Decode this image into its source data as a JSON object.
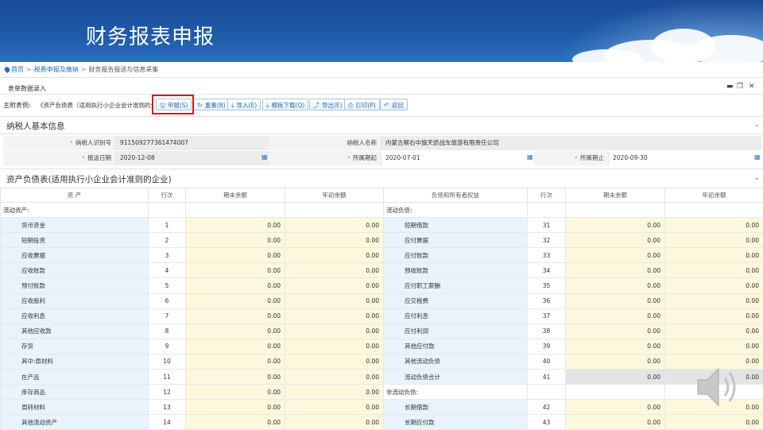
{
  "slide": {
    "title": "财务报表申报"
  },
  "breadcrumb": {
    "home": "首页",
    "level1": "税费申报及缴纳",
    "current": "财务报告报送与信息采集"
  },
  "panel": {
    "title": "表单数据录入"
  },
  "toolbar": {
    "attach_label": "主附表例:",
    "attach_value": "《资产负债表（适用执行小企业会计准则的企业）》",
    "buttons": [
      {
        "label": "申报(S)",
        "icon": "save-icon"
      },
      {
        "label": "重置(B)",
        "icon": "refresh-icon"
      },
      {
        "label": "导入(E)",
        "icon": "import-icon"
      },
      {
        "label": "模板下载(Q)",
        "icon": "download-icon"
      },
      {
        "label": "导出(E)",
        "icon": "export-icon"
      },
      {
        "label": "打印(P)",
        "icon": "print-icon"
      },
      {
        "label": "返回",
        "icon": "back-icon"
      }
    ]
  },
  "taxpayer": {
    "section_title": "纳税人基本信息",
    "id_label": "纳税人识别号",
    "id_value": "911509277361474007",
    "name_label": "纳税人名称",
    "name_value": "内蒙古察右中旗天骄战车旅游有限责任公司",
    "report_date_label": "报送日期",
    "report_date_value": "2020-12-08",
    "period_start_label": "所属期起",
    "period_start_value": "2020-07-01",
    "period_end_label": "所属期止",
    "period_end_value": "2020-09-30"
  },
  "balance_sheet": {
    "section_title": "资产负债表(适用执行小企业会计准则的企业)",
    "headers": [
      "资 产",
      "行次",
      "期末余额",
      "年初余额",
      "负债和所有者权益",
      "行次",
      "期末余额",
      "年初余额"
    ],
    "rows": [
      {
        "la": "流动资产:",
        "lr": "",
        "le": "",
        "lb": "",
        "ra": "流动负债:",
        "rr": "",
        "re": "",
        "rb": "",
        "lh": true,
        "rh": true
      },
      {
        "la": "货币资金",
        "lr": "1",
        "le": "0.00",
        "lb": "0.00",
        "ra": "短期借款",
        "rr": "31",
        "re": "0.00",
        "rb": "0.00"
      },
      {
        "la": "短期投资",
        "lr": "2",
        "le": "0.00",
        "lb": "0.00",
        "ra": "应付票据",
        "rr": "32",
        "re": "0.00",
        "rb": "0.00"
      },
      {
        "la": "应收票据",
        "lr": "3",
        "le": "0.00",
        "lb": "0.00",
        "ra": "应付账款",
        "rr": "33",
        "re": "0.00",
        "rb": "0.00"
      },
      {
        "la": "应收账款",
        "lr": "4",
        "le": "0.00",
        "lb": "0.00",
        "ra": "预收账款",
        "rr": "34",
        "re": "0.00",
        "rb": "0.00"
      },
      {
        "la": "预付账款",
        "lr": "5",
        "le": "0.00",
        "lb": "0.00",
        "ra": "应付职工薪酬",
        "rr": "35",
        "re": "0.00",
        "rb": "0.00"
      },
      {
        "la": "应收股利",
        "lr": "6",
        "le": "0.00",
        "lb": "0.00",
        "ra": "应交税费",
        "rr": "36",
        "re": "0.00",
        "rb": "0.00"
      },
      {
        "la": "应收利息",
        "lr": "7",
        "le": "0.00",
        "lb": "0.00",
        "ra": "应付利息",
        "rr": "37",
        "re": "0.00",
        "rb": "0.00"
      },
      {
        "la": "其他应收款",
        "lr": "8",
        "le": "0.00",
        "lb": "0.00",
        "ra": "应付利润",
        "rr": "38",
        "re": "0.00",
        "rb": "0.00"
      },
      {
        "la": "存货",
        "lr": "9",
        "le": "0.00",
        "lb": "0.00",
        "ra": "其他应付款",
        "rr": "39",
        "re": "0.00",
        "rb": "0.00"
      },
      {
        "la": "其中:原材料",
        "lr": "10",
        "le": "0.00",
        "lb": "0.00",
        "ra": "其他流动负债",
        "rr": "40",
        "re": "0.00",
        "rb": "0.00"
      },
      {
        "la": "在产品",
        "lr": "11",
        "le": "0.00",
        "lb": "0.00",
        "ra": "流动负债合计",
        "rr": "41",
        "re": "0.00",
        "rb": "0.00",
        "rgrey": true
      },
      {
        "la": "库存商品",
        "lr": "12",
        "le": "0.00",
        "lb": "0.00",
        "ra": "非流动负债:",
        "rr": "",
        "re": "",
        "rb": "",
        "rh": true
      },
      {
        "la": "周转材料",
        "lr": "13",
        "le": "0.00",
        "lb": "0.00",
        "ra": "长期借款",
        "rr": "42",
        "re": "0.00",
        "rb": "0.00"
      },
      {
        "la": "其他流动资产",
        "lr": "14",
        "le": "0.00",
        "lb": "0.00",
        "ra": "长期应付款",
        "rr": "43",
        "re": "0.00",
        "rb": "0.00"
      }
    ]
  },
  "colors": {
    "banner": "#1d5aa8",
    "highlight": "#e0131b",
    "link": "#1f6fb8",
    "amount_bg": "#fdf8dc",
    "name_bg": "#e8f3fb"
  }
}
